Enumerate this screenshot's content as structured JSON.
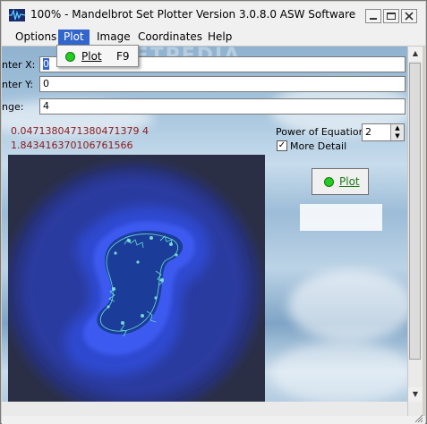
{
  "window": {
    "title": "100% - Mandelbrot Set Plotter Version 3.0.8.0  ASW Software",
    "app_icon": "waveform-icon",
    "controls": [
      "minimize-icon",
      "maximize-icon",
      "close-icon"
    ]
  },
  "menubar": {
    "items": [
      {
        "label": "Options"
      },
      {
        "label": "Plot"
      },
      {
        "label": "Image"
      },
      {
        "label": "Coordinates"
      },
      {
        "label": "Help"
      }
    ],
    "active": "Plot"
  },
  "plot_menu": {
    "item_icon": "green-dot-icon",
    "item_label": "Plot",
    "item_shortcut": "F9"
  },
  "fields": {
    "center_x": {
      "label": "nter X:",
      "value": "0"
    },
    "center_y": {
      "label": "nter Y:",
      "value": "0"
    },
    "range": {
      "label": "nge:",
      "value": "4"
    }
  },
  "readouts": {
    "line1": "0.0471380471380471379 4",
    "line2": "1.843416370106761566"
  },
  "power": {
    "label": "Power of Equation:",
    "value": "2",
    "up_icon": "spin-up-icon",
    "down_icon": "spin-down-icon"
  },
  "more_detail": {
    "label": "More Detail",
    "checked": true
  },
  "plot_button": {
    "label": "Plot",
    "icon": "green-dot-icon"
  },
  "watermark": "SOFTPEDIA",
  "colors": {
    "menu_highlight": "#3366cc",
    "readout_text": "#8b1a1a",
    "plot_dot": "#22cc22",
    "fractal_outer": "#2b2f45",
    "fractal_glow": "#3a4fe0"
  }
}
